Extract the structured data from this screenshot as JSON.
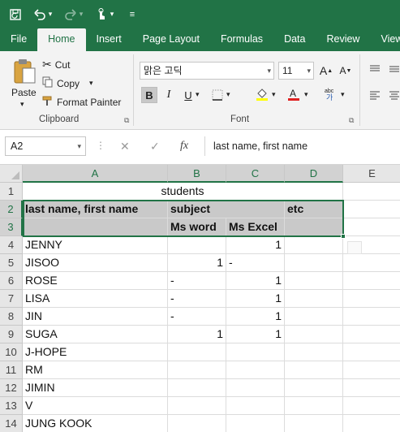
{
  "quick_access": {
    "icons": [
      "save-icon",
      "undo-icon",
      "redo-icon",
      "touch-mode-icon",
      "customize-icon"
    ]
  },
  "tabs": [
    "File",
    "Home",
    "Insert",
    "Page Layout",
    "Formulas",
    "Data",
    "Review",
    "View"
  ],
  "active_tab": "Home",
  "ribbon": {
    "clipboard": {
      "paste": "Paste",
      "cut": "Cut",
      "copy": "Copy",
      "format_painter": "Format Painter",
      "label": "Clipboard"
    },
    "font": {
      "font_name": "맑은 고딕",
      "font_size": "11",
      "bold": "B",
      "italic": "I",
      "underline": "U",
      "label": "Font"
    }
  },
  "formula_bar": {
    "name_box": "A2",
    "fx": "fx",
    "content": "last name, first name"
  },
  "columns": [
    "A",
    "B",
    "C",
    "D",
    "E"
  ],
  "rows": [
    "1",
    "2",
    "3",
    "4",
    "5",
    "6",
    "7",
    "8",
    "9",
    "10",
    "11",
    "12",
    "13",
    "14"
  ],
  "cells": {
    "r1_title": "students",
    "r2": {
      "a": "last name, first name",
      "b": "subject",
      "c": "",
      "d": "etc"
    },
    "r3": {
      "a": "",
      "b": "Ms word",
      "c": "Ms Excel",
      "d": ""
    },
    "data": [
      {
        "a": "JENNY",
        "b": "",
        "c": "1",
        "d": ""
      },
      {
        "a": "JISOO",
        "b": "1",
        "c": "-",
        "d": ""
      },
      {
        "a": "ROSE",
        "b": "-",
        "c": "1",
        "d": ""
      },
      {
        "a": "LISA",
        "b": "-",
        "c": "1",
        "d": ""
      },
      {
        "a": "JIN",
        "b": "-",
        "c": "1",
        "d": ""
      },
      {
        "a": "SUGA",
        "b": "1",
        "c": "1",
        "d": ""
      },
      {
        "a": "J-HOPE",
        "b": "",
        "c": "",
        "d": ""
      },
      {
        "a": "RM",
        "b": "",
        "c": "",
        "d": ""
      },
      {
        "a": "JIMIN",
        "b": "",
        "c": "",
        "d": ""
      },
      {
        "a": "V",
        "b": "",
        "c": "",
        "d": ""
      },
      {
        "a": "JUNG KOOK",
        "b": "",
        "c": "",
        "d": ""
      }
    ]
  },
  "colors": {
    "excel_green": "#217346",
    "header_shade": "#c9c9c9"
  }
}
